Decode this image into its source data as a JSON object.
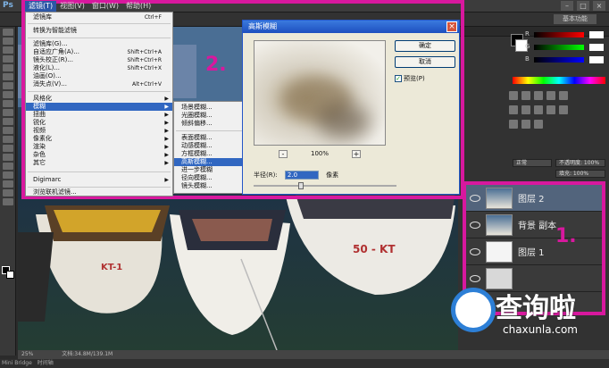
{
  "app": {
    "logo": "Ps",
    "workspace": "基本功能"
  },
  "menubar": {
    "items": [
      "滤镜(T)",
      "视图(V)",
      "窗口(W)",
      "帮助(H)"
    ],
    "active_index": 0
  },
  "filter_menu": {
    "items": [
      {
        "label": "滤镜库",
        "shortcut": "Ctrl+F"
      },
      {
        "label": "转换为智能滤镜"
      },
      {
        "label": "滤镜库(G)..."
      },
      {
        "label": "自适应广角(A)...",
        "shortcut": "Shift+Ctrl+A"
      },
      {
        "label": "镜头校正(R)...",
        "shortcut": "Shift+Ctrl+R"
      },
      {
        "label": "液化(L)...",
        "shortcut": "Shift+Ctrl+X"
      },
      {
        "label": "油画(O)..."
      },
      {
        "label": "消失点(V)...",
        "shortcut": "Alt+Ctrl+V"
      },
      {
        "label": "风格化",
        "has_submenu": true
      },
      {
        "label": "模糊",
        "has_submenu": true,
        "highlighted": true
      },
      {
        "label": "扭曲",
        "has_submenu": true
      },
      {
        "label": "锐化",
        "has_submenu": true
      },
      {
        "label": "视频",
        "has_submenu": true
      },
      {
        "label": "像素化",
        "has_submenu": true
      },
      {
        "label": "渲染",
        "has_submenu": true
      },
      {
        "label": "杂色",
        "has_submenu": true
      },
      {
        "label": "其它",
        "has_submenu": true
      },
      {
        "label": "Digimarc",
        "has_submenu": true
      },
      {
        "label": "浏览联机滤镜..."
      }
    ]
  },
  "blur_submenu": {
    "items": [
      {
        "label": "场景模糊..."
      },
      {
        "label": "光圈模糊..."
      },
      {
        "label": "倾斜偏移..."
      },
      {
        "label": "表面模糊..."
      },
      {
        "label": "动感模糊..."
      },
      {
        "label": "方框模糊..."
      },
      {
        "label": "高斯模糊...",
        "highlighted": true
      },
      {
        "label": "进一步模糊"
      },
      {
        "label": "径向模糊..."
      },
      {
        "label": "镜头模糊..."
      }
    ]
  },
  "gaussian_dialog": {
    "title": "高斯模糊",
    "ok_label": "确定",
    "cancel_label": "取消",
    "preview_label": "预览(P)",
    "preview_checked": true,
    "zoom": "100%",
    "radius_label": "半径(R):",
    "radius_value": "2.0",
    "radius_unit": "像素"
  },
  "annotations": {
    "step1": "1.",
    "step2": "2."
  },
  "layers": [
    {
      "name": "图层 2",
      "active": true
    },
    {
      "name": "背景 副本",
      "active": false
    },
    {
      "name": "图层 1",
      "active": false
    },
    {
      "name": "",
      "active": false
    }
  ],
  "layer_options": {
    "blend_mode": "正常",
    "opacity": "不透明度: 100%",
    "fill": "填充: 100%"
  },
  "status": {
    "zoom": "25%",
    "doc": "文档:34.8M/139.1M"
  },
  "bottom_tabs": [
    "Mini Bridge",
    "时间轴"
  ],
  "watermark": {
    "text": "查询啦",
    "url": "chaxunla.com"
  },
  "colors": {
    "highlight": "#d8189e",
    "menu_active": "#3167c1"
  }
}
